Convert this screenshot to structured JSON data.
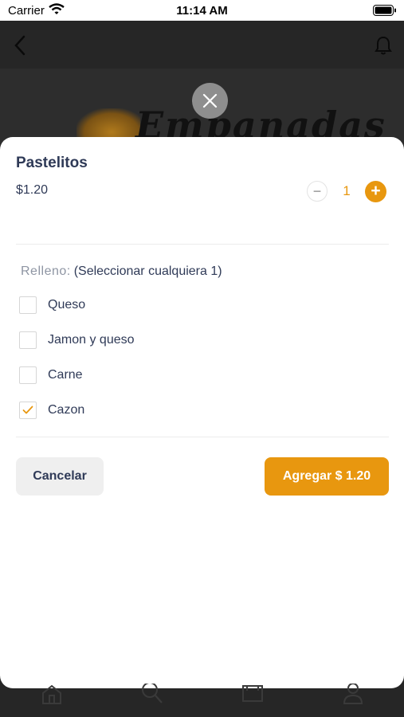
{
  "status_bar": {
    "carrier": "Carrier",
    "time": "11:14 AM"
  },
  "app_bar": {
    "back_icon": "chevron-left-icon",
    "bell_icon": "bell-icon"
  },
  "banner": {
    "logo_text": "Empanadas"
  },
  "product": {
    "name": "Pastelitos",
    "price": "$1.20",
    "quantity": "1",
    "minus_label": "−",
    "plus_label": "+"
  },
  "options_group": {
    "label": "Relleno:",
    "hint": "(Seleccionar cualquiera 1)",
    "items": [
      {
        "label": "Queso",
        "checked": false
      },
      {
        "label": "Jamon y queso",
        "checked": false
      },
      {
        "label": "Carne",
        "checked": false
      },
      {
        "label": "Cazon",
        "checked": true
      }
    ]
  },
  "actions": {
    "cancel_label": "Cancelar",
    "add_label": "Agregar $ 1.20"
  },
  "colors": {
    "accent": "#e8970f",
    "text": "#2f3a57",
    "muted": "#8e95a3",
    "overlay": "#262626"
  }
}
